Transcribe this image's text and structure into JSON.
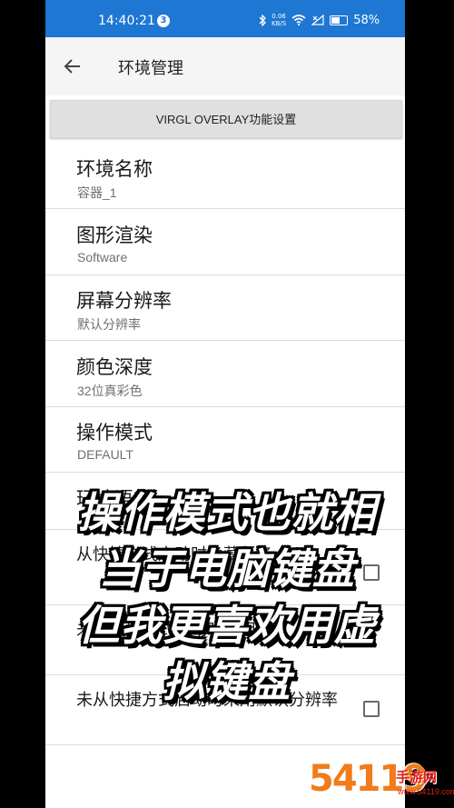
{
  "status_bar": {
    "time": "14:40:21",
    "notification_count": "3",
    "net_speed_value": "0.06",
    "net_speed_unit": "KB/S",
    "battery": "58%",
    "battery_level": 0.58,
    "background": "#1e77d3"
  },
  "app_bar": {
    "back_icon": "arrow-left-icon",
    "title": "环境管理"
  },
  "virgl_button": "VIRGL OVERLAY功能设置",
  "settings": [
    {
      "title": "环境名称",
      "summary": "容器_1"
    },
    {
      "title": "图形渲染",
      "summary": "Software"
    },
    {
      "title": "屏幕分辨率",
      "summary": "默认分辨率"
    },
    {
      "title": "颜色深度",
      "summary": "32位真彩色"
    },
    {
      "title": "操作模式",
      "summary": "DEFAULT"
    },
    {
      "title": "环境语言"
    },
    {
      "title": "从快捷方式启动时隐藏任务"
    },
    {
      "title": "未从快捷方式启动时采用默"
    },
    {
      "title": "未从快捷方式启动时采用默认分辨率"
    }
  ],
  "caption": [
    "操作模式也就相",
    "当于电脑键盘",
    "但我更喜欢用虚",
    "拟键盘"
  ],
  "watermark": {
    "number": "54119",
    "name": "手游网",
    "site": "www.54119.com",
    "color": "#e0201b"
  }
}
